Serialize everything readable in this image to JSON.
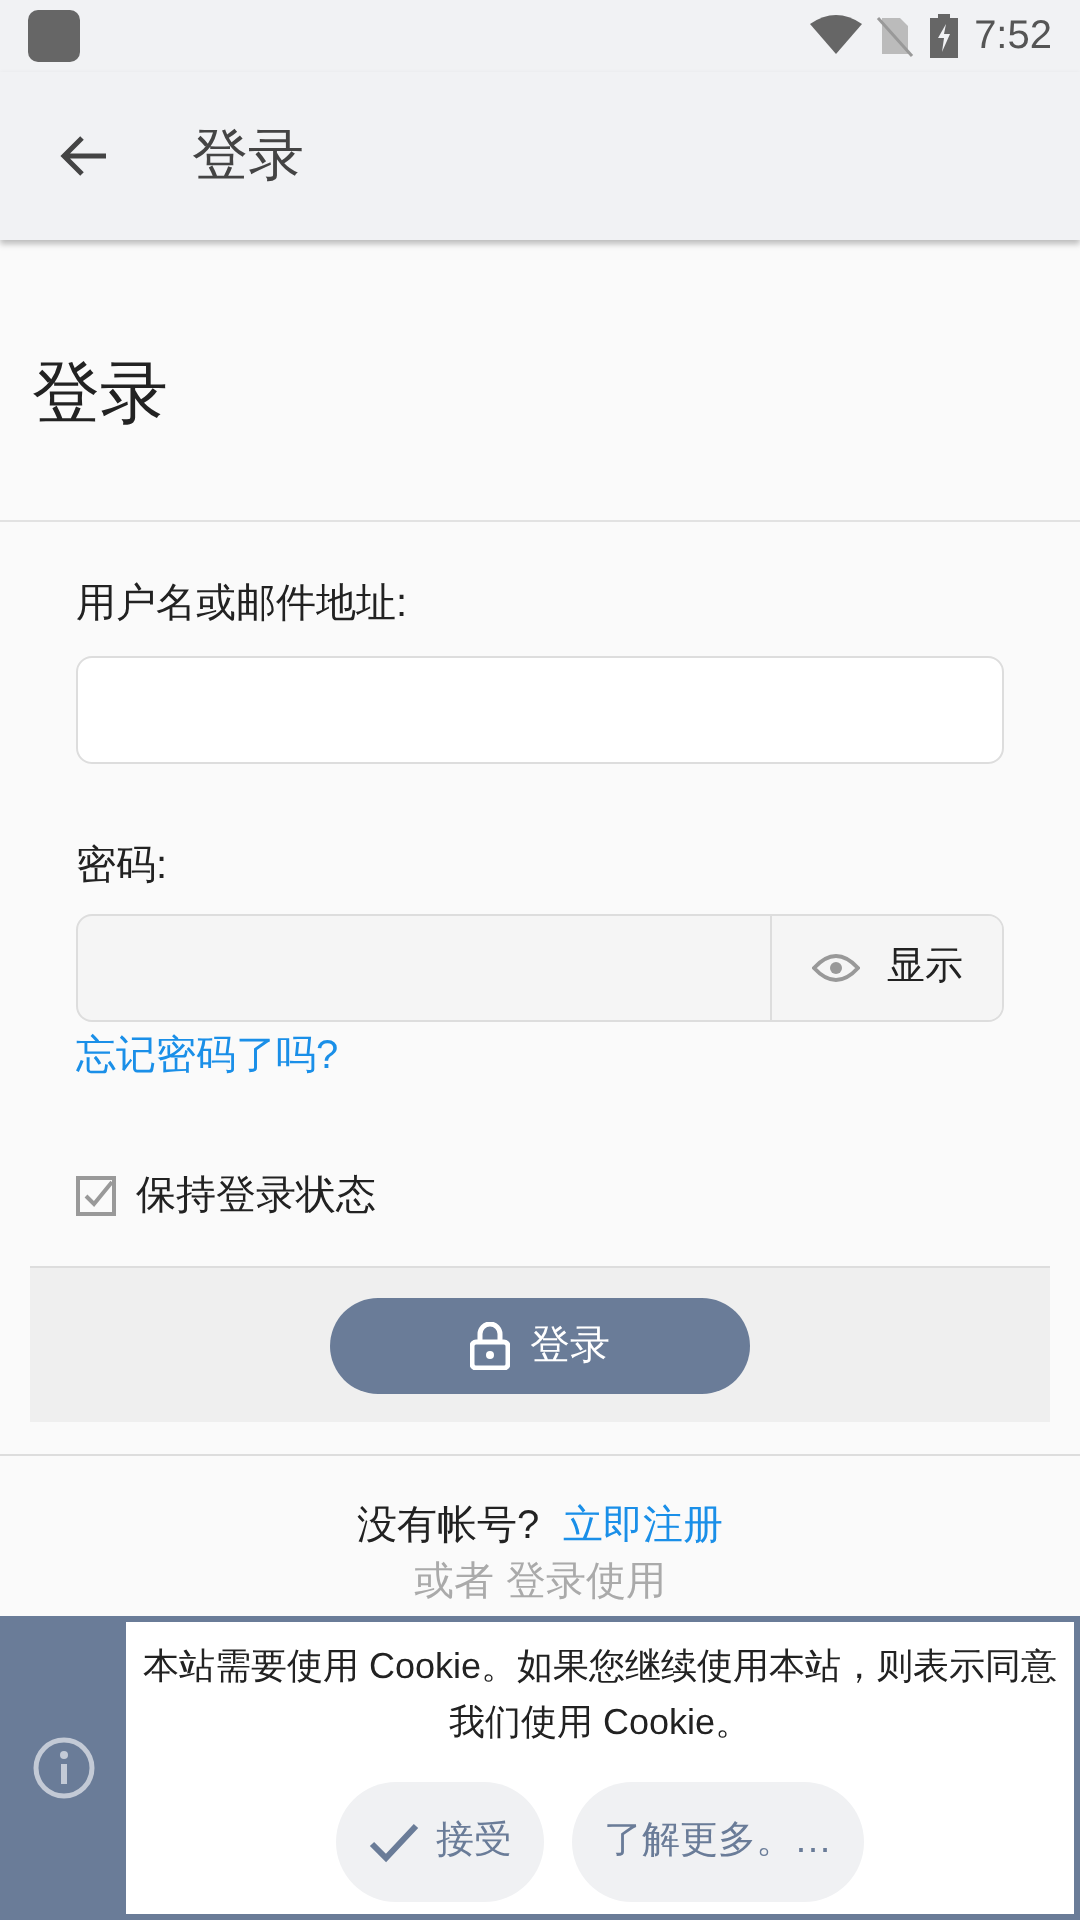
{
  "status_bar": {
    "time": "7:52"
  },
  "app_bar": {
    "title": "登录"
  },
  "page": {
    "heading": "登录"
  },
  "form": {
    "username_label": "用户名或邮件地址:",
    "password_label": "密码:",
    "show_password": {
      "label": "显示",
      "selected": false
    },
    "forgot_link": "忘记密码了吗?",
    "remember": {
      "label": "保持登录状态",
      "checked": true
    },
    "submit": "登录"
  },
  "register": {
    "prompt": "没有帐号?",
    "link": "立即注册"
  },
  "alt_login": "或者 登录使用",
  "cookie_banner": {
    "message": "本站需要使用 Cookie。如果您继续使用本站，则表示同意我们使用 Cookie。",
    "buttons": [
      {
        "kind": "accept",
        "label": "接受"
      },
      {
        "kind": "more",
        "label": "了解更多。…"
      }
    ]
  }
}
